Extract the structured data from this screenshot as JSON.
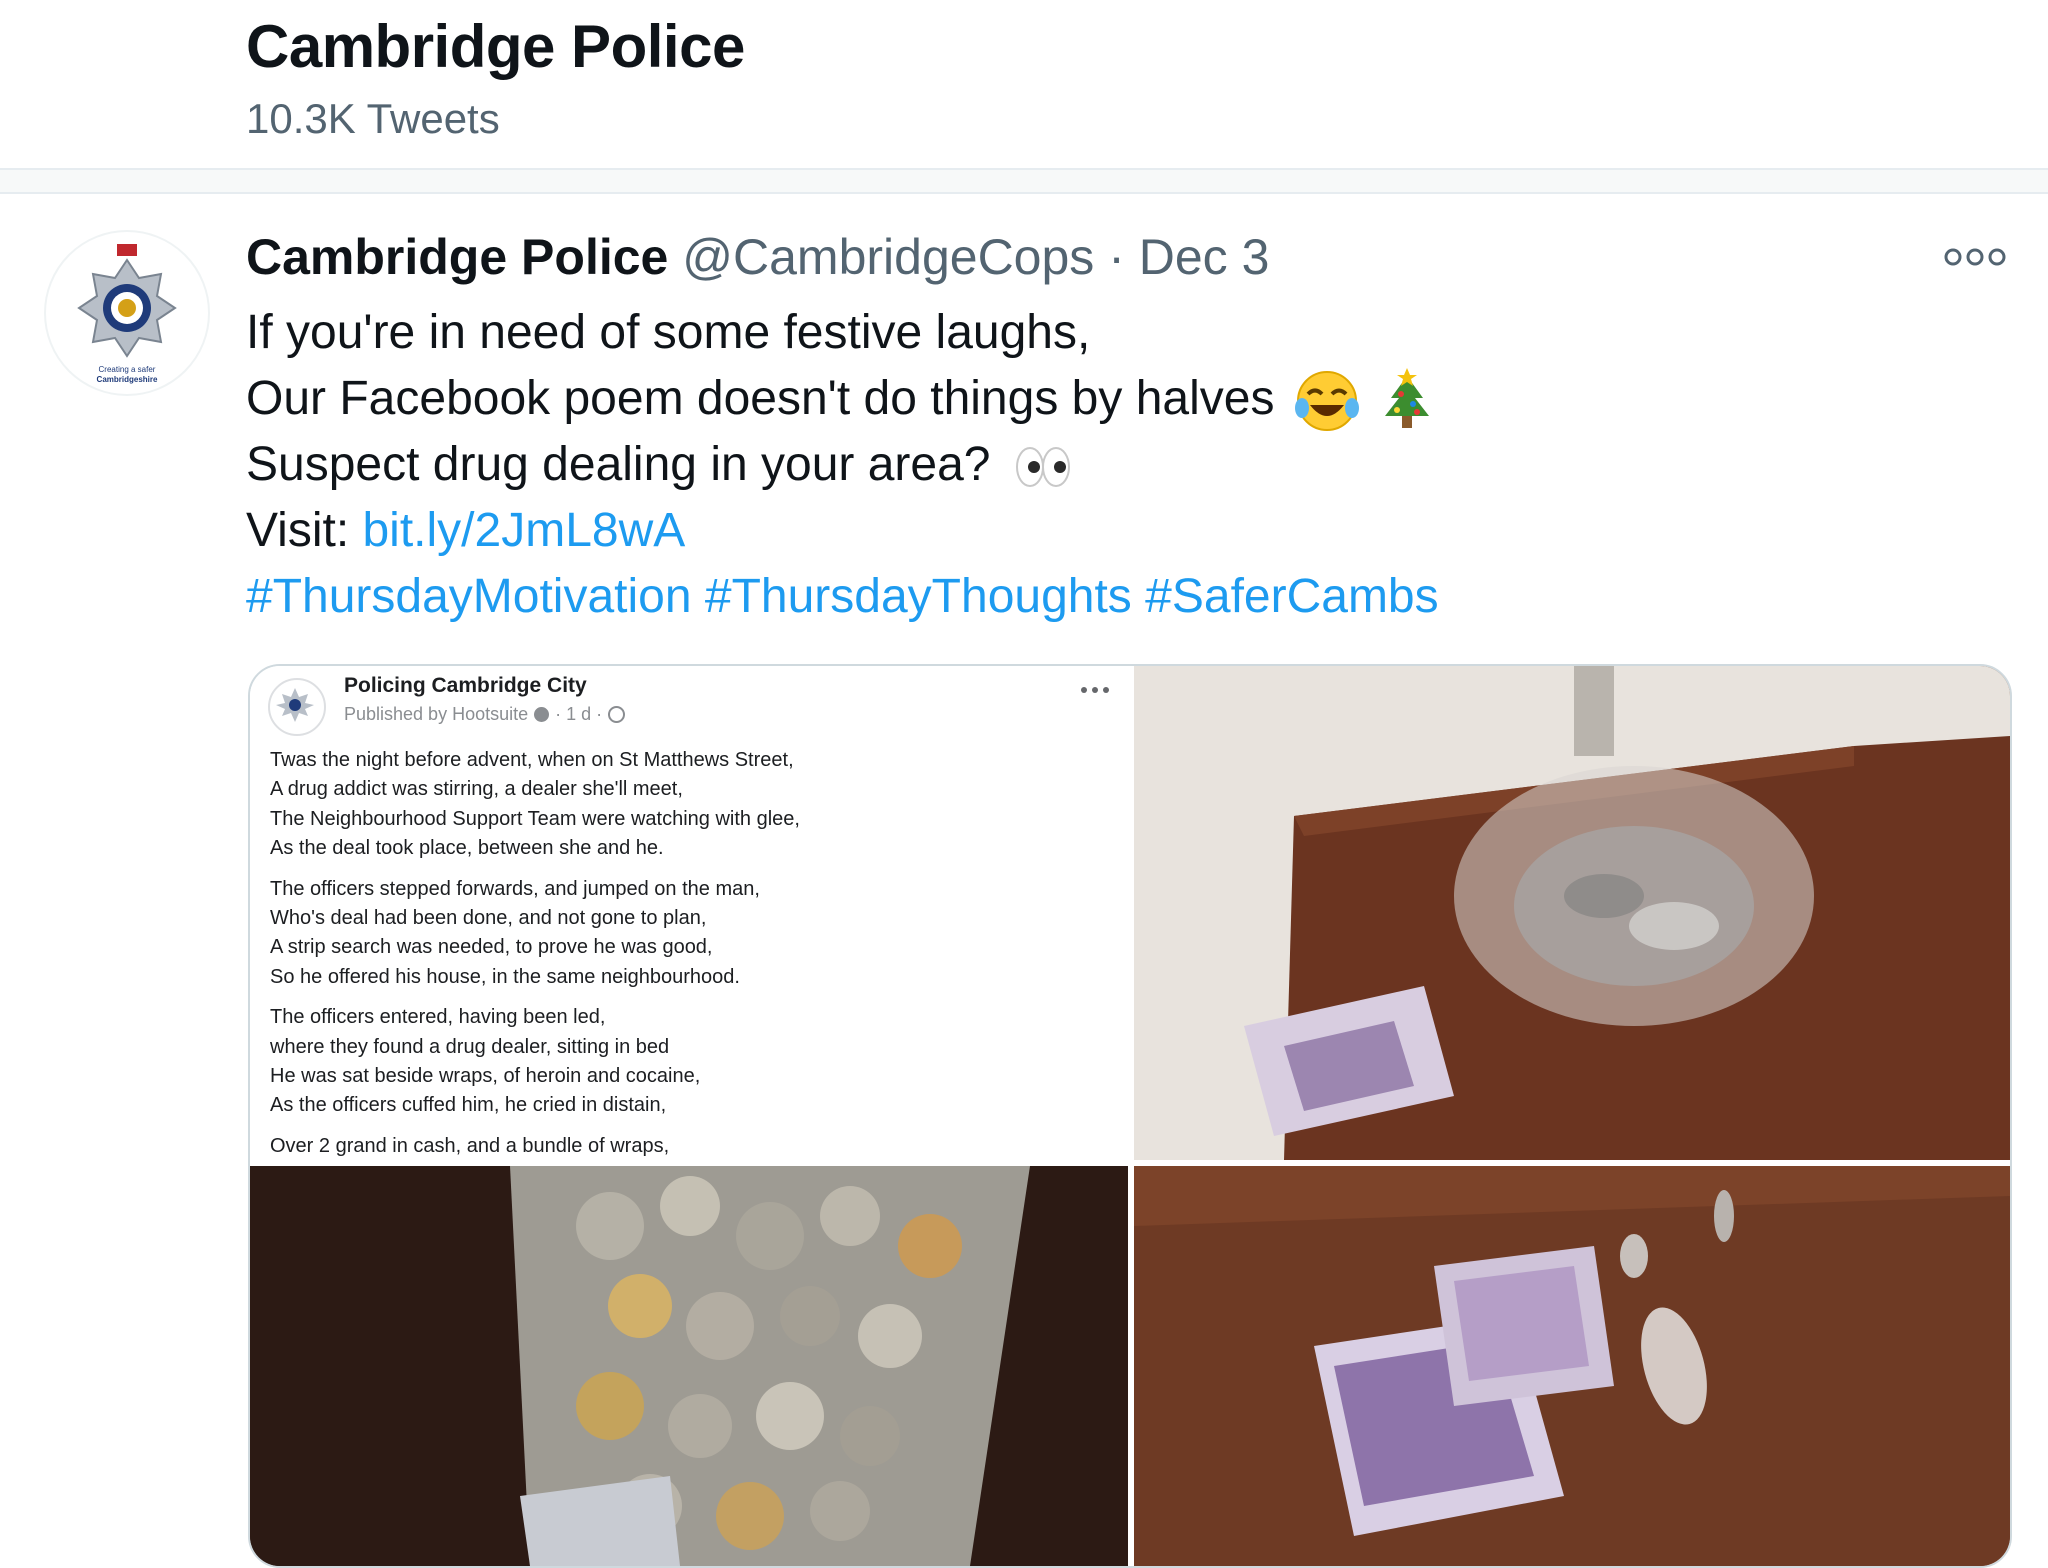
{
  "header": {
    "title": "Cambridge Police",
    "tweet_count": "10.3K Tweets"
  },
  "tweet": {
    "author_name": "Cambridge Police",
    "handle": "@CambridgeCops",
    "separator": "·",
    "date": "Dec 3",
    "lines": [
      "If you're in need of some festive laughs,",
      "Our Facebook poem doesn't do things by halves",
      "Suspect drug dealing in your area?"
    ],
    "visit_label": "Visit: ",
    "link": "bit.ly/2JmL8wA",
    "hashtags": [
      "#ThursdayMotivation",
      "#ThursdayThoughts",
      "#SaferCambs"
    ],
    "icons": [
      "tears-of-joy-emoji-icon",
      "christmas-tree-emoji-icon",
      "eyes-emoji-icon",
      "more-options-icon"
    ]
  },
  "avatar": {
    "caption_line1": "Creating a safer",
    "caption_line2": "Cambridgeshire"
  },
  "media": {
    "fb_post": {
      "page_name": "Policing Cambridge City",
      "published_by": "Published by Hootsuite",
      "age": "· 1 d ·",
      "stanzas": [
        [
          "Twas the night before advent, when on St Matthews Street,",
          "A drug addict was stirring, a dealer she'll meet,",
          "The Neighbourhood Support Team were watching with glee,",
          "As the deal took place, between she and he."
        ],
        [
          "The officers stepped forwards, and jumped on the man,",
          "Who's deal had been done, and not gone to plan,",
          "A strip search was needed, to prove he was good,",
          "So he offered his house, in the same neighbourhood."
        ],
        [
          "The officers entered, having been led,",
          "where they found a drug dealer, sitting in bed",
          "He was sat beside wraps, of heroin and cocaine,",
          "As the officers cuffed him, he cried in distain,"
        ],
        [
          "Over 2 grand in cash, and a bundle of wraps,"
        ]
      ]
    }
  },
  "colors": {
    "link": "#1d9bf0",
    "text_primary": "#0f1419",
    "text_secondary": "#536471",
    "border": "#cfd9de"
  }
}
